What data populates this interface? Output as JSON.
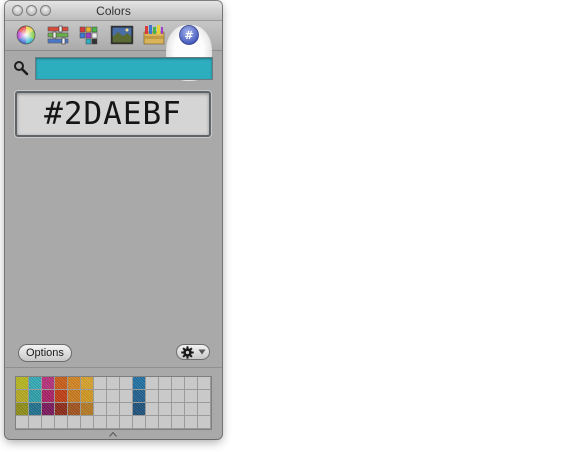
{
  "window": {
    "title": "Colors"
  },
  "toolbar": {
    "tools": [
      {
        "name": "color-wheel",
        "icon": "color-wheel-icon"
      },
      {
        "name": "color-sliders",
        "icon": "sliders-icon"
      },
      {
        "name": "color-palettes",
        "icon": "palettes-icon"
      },
      {
        "name": "image-palettes",
        "icon": "image-icon"
      },
      {
        "name": "crayons",
        "icon": "crayons-icon"
      },
      {
        "name": "hex-color-picker",
        "icon": "hash-icon",
        "selected": true
      }
    ]
  },
  "search": {
    "value": "",
    "color": "#2daebf"
  },
  "hex": {
    "value": "#2DAEBF"
  },
  "footer": {
    "options_label": "Options",
    "action_icon": "gear-icon"
  },
  "swatches": {
    "rows": [
      [
        "#b5b51c",
        "#30a8b4",
        "#b42d78",
        "#c85a14",
        "#d2821e",
        "#d6a028",
        "",
        "",
        "",
        "#1e6ea0",
        "",
        "",
        "",
        "",
        ""
      ],
      [
        "#b4a81e",
        "#2a9ea8",
        "#a81e64",
        "#be3c10",
        "#c8781a",
        "#d0961e",
        "",
        "",
        "",
        "#1c5f8c",
        "",
        "",
        "",
        "",
        ""
      ],
      [
        "#8c8c14",
        "#1e6e8c",
        "#7a145a",
        "#8c2814",
        "#a0501a",
        "#b4781e",
        "",
        "",
        "",
        "#1a4f78",
        "",
        "",
        "",
        "",
        ""
      ],
      [
        "",
        "",
        "",
        "",
        "",
        "",
        "",
        "",
        "",
        "",
        "",
        "",
        "",
        "",
        ""
      ]
    ]
  }
}
